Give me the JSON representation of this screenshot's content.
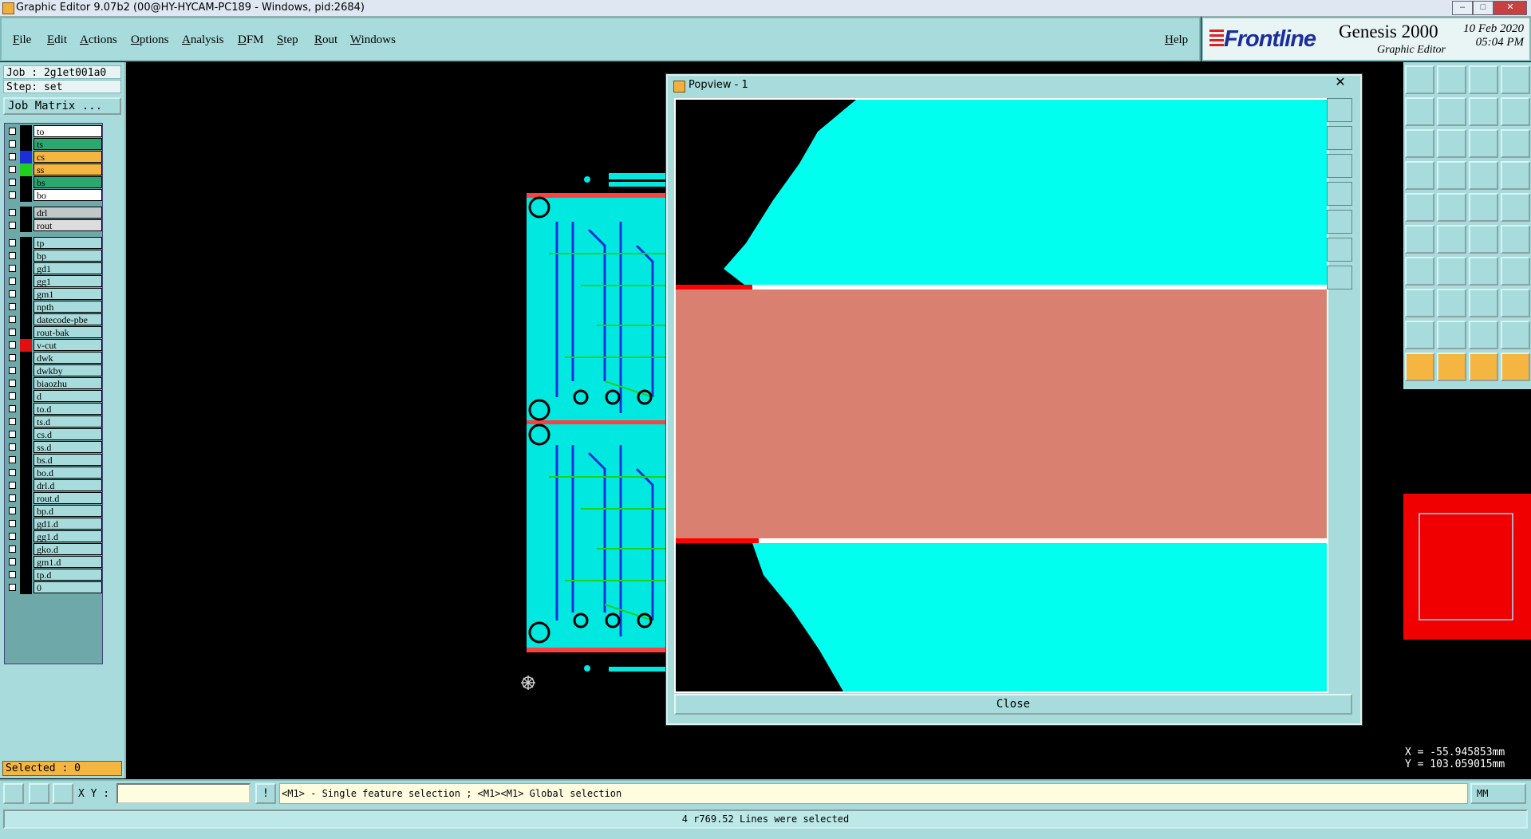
{
  "window": {
    "title": "Graphic Editor 9.07b2 (00@HY-HYCAM-PC189 - Windows, pid:2684)",
    "minimize": "–",
    "maximize": "□",
    "close": "✕"
  },
  "menubar": {
    "items": [
      "File",
      "Edit",
      "Actions",
      "Options",
      "Analysis",
      "DFM",
      "Step",
      "Rout",
      "Windows"
    ],
    "help": "Help"
  },
  "brand": {
    "logo": "Frontline",
    "product": "Genesis 2000",
    "subtitle": "Graphic Editor",
    "date": "10 Feb 2020",
    "time": "05:04 PM"
  },
  "job": {
    "job_label": "Job : 2g1et001a0",
    "step_label": "Step: set",
    "matrix_button": "Job Matrix ..."
  },
  "layers": [
    {
      "name": "to",
      "color": "#ffffff",
      "swatch": "#000000"
    },
    {
      "name": "ts",
      "color": "#2aa870",
      "swatch": "#000000"
    },
    {
      "name": "cs",
      "color": "#f5b541",
      "swatch": "#1a2fd6"
    },
    {
      "name": "ss",
      "color": "#f5b541",
      "swatch": "#20d020"
    },
    {
      "name": "bs",
      "color": "#2aa870",
      "swatch": "#000000"
    },
    {
      "name": "bo",
      "color": "#ffffff",
      "swatch": "#000000"
    },
    {
      "name": "drl",
      "color": "#c0c8c8",
      "swatch": "#000000"
    },
    {
      "name": "rout",
      "color": "#dcdcdc",
      "swatch": "#000000"
    },
    {
      "name": "tp",
      "color": "#a8dcdc",
      "swatch": "#000000"
    },
    {
      "name": "bp",
      "color": "#a8dcdc",
      "swatch": "#000000"
    },
    {
      "name": "gd1",
      "color": "#a8dcdc",
      "swatch": "#000000"
    },
    {
      "name": "gg1",
      "color": "#a8dcdc",
      "swatch": "#000000"
    },
    {
      "name": "gm1",
      "color": "#a8dcdc",
      "swatch": "#000000"
    },
    {
      "name": "npth",
      "color": "#a8dcdc",
      "swatch": "#000000"
    },
    {
      "name": "datecode-pbe",
      "color": "#a8dcdc",
      "swatch": "#000000"
    },
    {
      "name": "rout-bak",
      "color": "#a8dcdc",
      "swatch": "#000000"
    },
    {
      "name": "v-cut",
      "color": "#a8dcdc",
      "swatch": "#e01010"
    },
    {
      "name": "dwk",
      "color": "#a8dcdc",
      "swatch": "#000000"
    },
    {
      "name": "dwkby",
      "color": "#a8dcdc",
      "swatch": "#000000"
    },
    {
      "name": "biaozhu",
      "color": "#a8dcdc",
      "swatch": "#000000"
    },
    {
      "name": "d",
      "color": "#a8dcdc",
      "swatch": "#000000"
    },
    {
      "name": "to.d",
      "color": "#a8dcdc",
      "swatch": "#000000"
    },
    {
      "name": "ts.d",
      "color": "#a8dcdc",
      "swatch": "#000000"
    },
    {
      "name": "cs.d",
      "color": "#a8dcdc",
      "swatch": "#000000"
    },
    {
      "name": "ss.d",
      "color": "#a8dcdc",
      "swatch": "#000000"
    },
    {
      "name": "bs.d",
      "color": "#a8dcdc",
      "swatch": "#000000"
    },
    {
      "name": "bo.d",
      "color": "#a8dcdc",
      "swatch": "#000000"
    },
    {
      "name": "drl.d",
      "color": "#a8dcdc",
      "swatch": "#000000"
    },
    {
      "name": "rout.d",
      "color": "#a8dcdc",
      "swatch": "#000000"
    },
    {
      "name": "bp.d",
      "color": "#a8dcdc",
      "swatch": "#000000"
    },
    {
      "name": "gd1.d",
      "color": "#a8dcdc",
      "swatch": "#000000"
    },
    {
      "name": "gg1.d",
      "color": "#a8dcdc",
      "swatch": "#000000"
    },
    {
      "name": "gko.d",
      "color": "#a8dcdc",
      "swatch": "#000000"
    },
    {
      "name": "gm1.d",
      "color": "#a8dcdc",
      "swatch": "#000000"
    },
    {
      "name": "tp.d",
      "color": "#a8dcdc",
      "swatch": "#000000"
    },
    {
      "name": "0",
      "color": "#a8dcdc",
      "swatch": "#000000"
    }
  ],
  "selected": "Selected : 0",
  "popview": {
    "title": "Popview - 1",
    "close_x": "✕",
    "close_button": "Close"
  },
  "coords": {
    "x": "X = -55.945853mm",
    "y": "Y = 103.059015mm"
  },
  "bottom": {
    "xy_label": "X Y :",
    "xy_value": "",
    "hint": "<M1> - Single feature selection ; <M1><M1> Global selection",
    "unit": "MM"
  },
  "status": "4 r769.52 Lines were selected",
  "colors": {
    "panel": "#a8dcdc",
    "highlight": "#f5b541",
    "copper": "#00ffee",
    "vcut": "#d98070",
    "red": "#f00000"
  }
}
